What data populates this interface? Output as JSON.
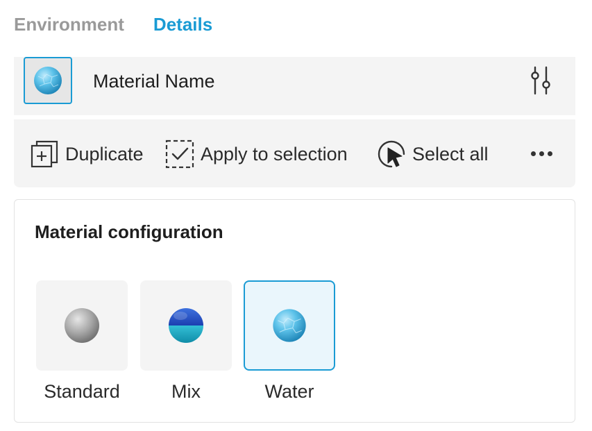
{
  "tabs": [
    {
      "label": "Environment",
      "active": false
    },
    {
      "label": "Details",
      "active": true
    }
  ],
  "material": {
    "name": "Material Name",
    "thumbnail_icon": "water-sphere-icon",
    "settings_icon": "sliders-icon"
  },
  "actions": {
    "duplicate": "Duplicate",
    "apply_to_selection": "Apply to selection",
    "select_all": "Select all",
    "more_icon": "more-horizontal-icon"
  },
  "configuration": {
    "title": "Material configuration",
    "options": [
      {
        "label": "Standard",
        "icon": "gray-sphere-icon",
        "selected": false
      },
      {
        "label": "Mix",
        "icon": "mix-sphere-icon",
        "selected": false
      },
      {
        "label": "Water",
        "icon": "water-sphere-icon",
        "selected": true
      }
    ]
  },
  "colors": {
    "accent": "#1a9bd4",
    "inactive_tab": "#9a9a9a",
    "panel_bg": "#f4f4f4",
    "selected_tile_bg": "#eaf6fc"
  }
}
